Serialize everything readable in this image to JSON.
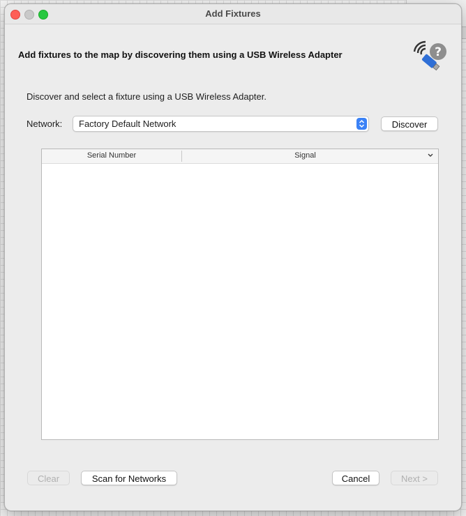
{
  "window": {
    "title": "Add Fixtures"
  },
  "heading": "Add fixtures to the map by discovering them using a USB Wireless Adapter",
  "intro": "Discover and select a fixture using a USB Wireless Adapter.",
  "network": {
    "label": "Network:",
    "selected": "Factory Default Network"
  },
  "buttons": {
    "discover": "Discover",
    "clear": "Clear",
    "scan": "Scan for Networks",
    "cancel": "Cancel",
    "next": "Next >"
  },
  "table": {
    "columns": [
      "Serial Number",
      "Signal"
    ],
    "rows": []
  },
  "icons": {
    "logo": "usb-wireless-help-icon",
    "stepper": "select-stepper-icon",
    "sort": "chevron-down-icon"
  },
  "colors": {
    "accent": "#3b82f6",
    "close": "#fe5f57",
    "maximize": "#28c840"
  }
}
